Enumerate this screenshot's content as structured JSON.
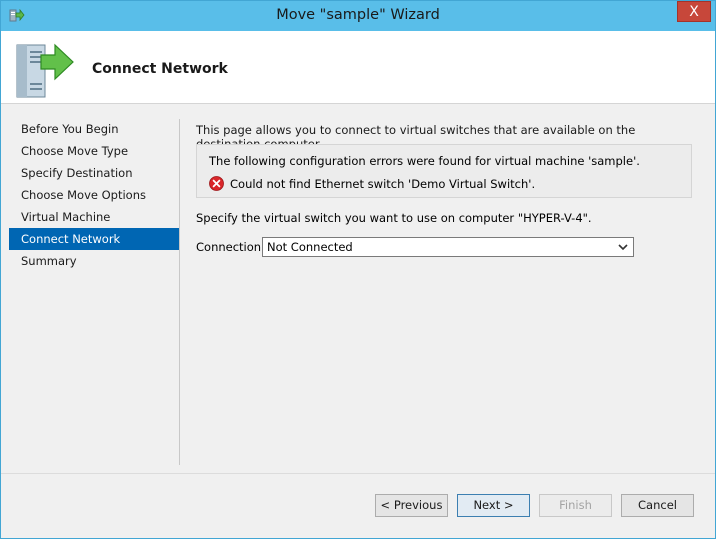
{
  "window": {
    "title": "Move \"sample\" Wizard",
    "close_label": "X"
  },
  "header": {
    "title": "Connect Network"
  },
  "sidebar": {
    "items": [
      {
        "label": "Before You Begin"
      },
      {
        "label": "Choose Move Type"
      },
      {
        "label": "Specify Destination"
      },
      {
        "label": "Choose Move Options"
      },
      {
        "label": "Virtual Machine"
      },
      {
        "label": "Connect Network",
        "active": true
      },
      {
        "label": "Summary"
      }
    ]
  },
  "content": {
    "intro": "This page allows you to connect to virtual switches that are available on the destination computer.",
    "error_header": "The following configuration errors were found for virtual machine 'sample'.",
    "error_message": "Could not find Ethernet switch 'Demo Virtual Switch'.",
    "specify": "Specify the virtual switch you want to use on computer \"HYPER-V-4\".",
    "connection_label": "Connection:",
    "connection_value": "Not Connected"
  },
  "buttons": {
    "previous": "< Previous",
    "next": "Next >",
    "finish": "Finish",
    "cancel": "Cancel"
  },
  "icons": {
    "app": "wizard-icon",
    "page": "server-move-icon",
    "error": "error-icon",
    "dropdown": "chevron-down-icon"
  },
  "colors": {
    "titlebar": "#59bee9",
    "active_nav": "#0066b3",
    "close": "#c7473a",
    "error": "#d9262a"
  }
}
